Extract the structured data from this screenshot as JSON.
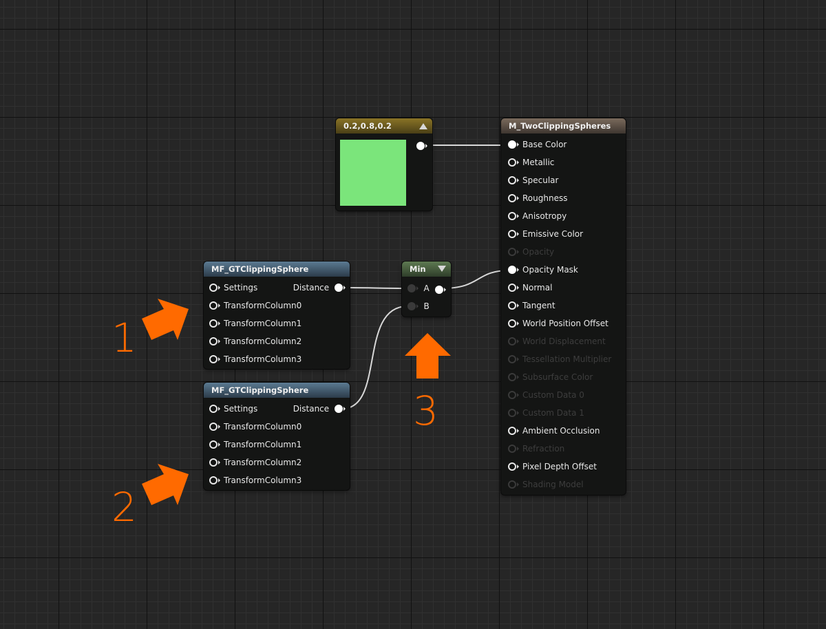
{
  "colors": {
    "accent_arrow": "#ff6a00",
    "swatch": "#7be57b"
  },
  "constant_node": {
    "title": "0.2,0.8,0.2",
    "swatch_color": "#7be57b"
  },
  "material_node": {
    "title": "M_TwoClippingSpheres",
    "inputs": [
      {
        "label": "Base Color",
        "state": "connected"
      },
      {
        "label": "Metallic",
        "state": "enabled"
      },
      {
        "label": "Specular",
        "state": "enabled"
      },
      {
        "label": "Roughness",
        "state": "enabled"
      },
      {
        "label": "Anisotropy",
        "state": "enabled"
      },
      {
        "label": "Emissive Color",
        "state": "enabled"
      },
      {
        "label": "Opacity",
        "state": "disabled"
      },
      {
        "label": "Opacity Mask",
        "state": "connected"
      },
      {
        "label": "Normal",
        "state": "enabled"
      },
      {
        "label": "Tangent",
        "state": "enabled"
      },
      {
        "label": "World Position Offset",
        "state": "enabled"
      },
      {
        "label": "World Displacement",
        "state": "disabled"
      },
      {
        "label": "Tessellation Multiplier",
        "state": "disabled"
      },
      {
        "label": "Subsurface Color",
        "state": "disabled"
      },
      {
        "label": "Custom Data 0",
        "state": "disabled"
      },
      {
        "label": "Custom Data 1",
        "state": "disabled"
      },
      {
        "label": "Ambient Occlusion",
        "state": "enabled"
      },
      {
        "label": "Refraction",
        "state": "disabled"
      },
      {
        "label": "Pixel Depth Offset",
        "state": "enabled"
      },
      {
        "label": "Shading Model",
        "state": "disabled"
      }
    ]
  },
  "function_nodes": [
    {
      "title": "MF_GTClippingSphere",
      "output": "Distance",
      "inputs": [
        "Settings",
        "TransformColumn0",
        "TransformColumn1",
        "TransformColumn2",
        "TransformColumn3"
      ]
    },
    {
      "title": "MF_GTClippingSphere",
      "output": "Distance",
      "inputs": [
        "Settings",
        "TransformColumn0",
        "TransformColumn1",
        "TransformColumn2",
        "TransformColumn3"
      ]
    }
  ],
  "min_node": {
    "title": "Min",
    "inputs": [
      "A",
      "B"
    ]
  },
  "callouts": [
    "1",
    "2",
    "3"
  ]
}
